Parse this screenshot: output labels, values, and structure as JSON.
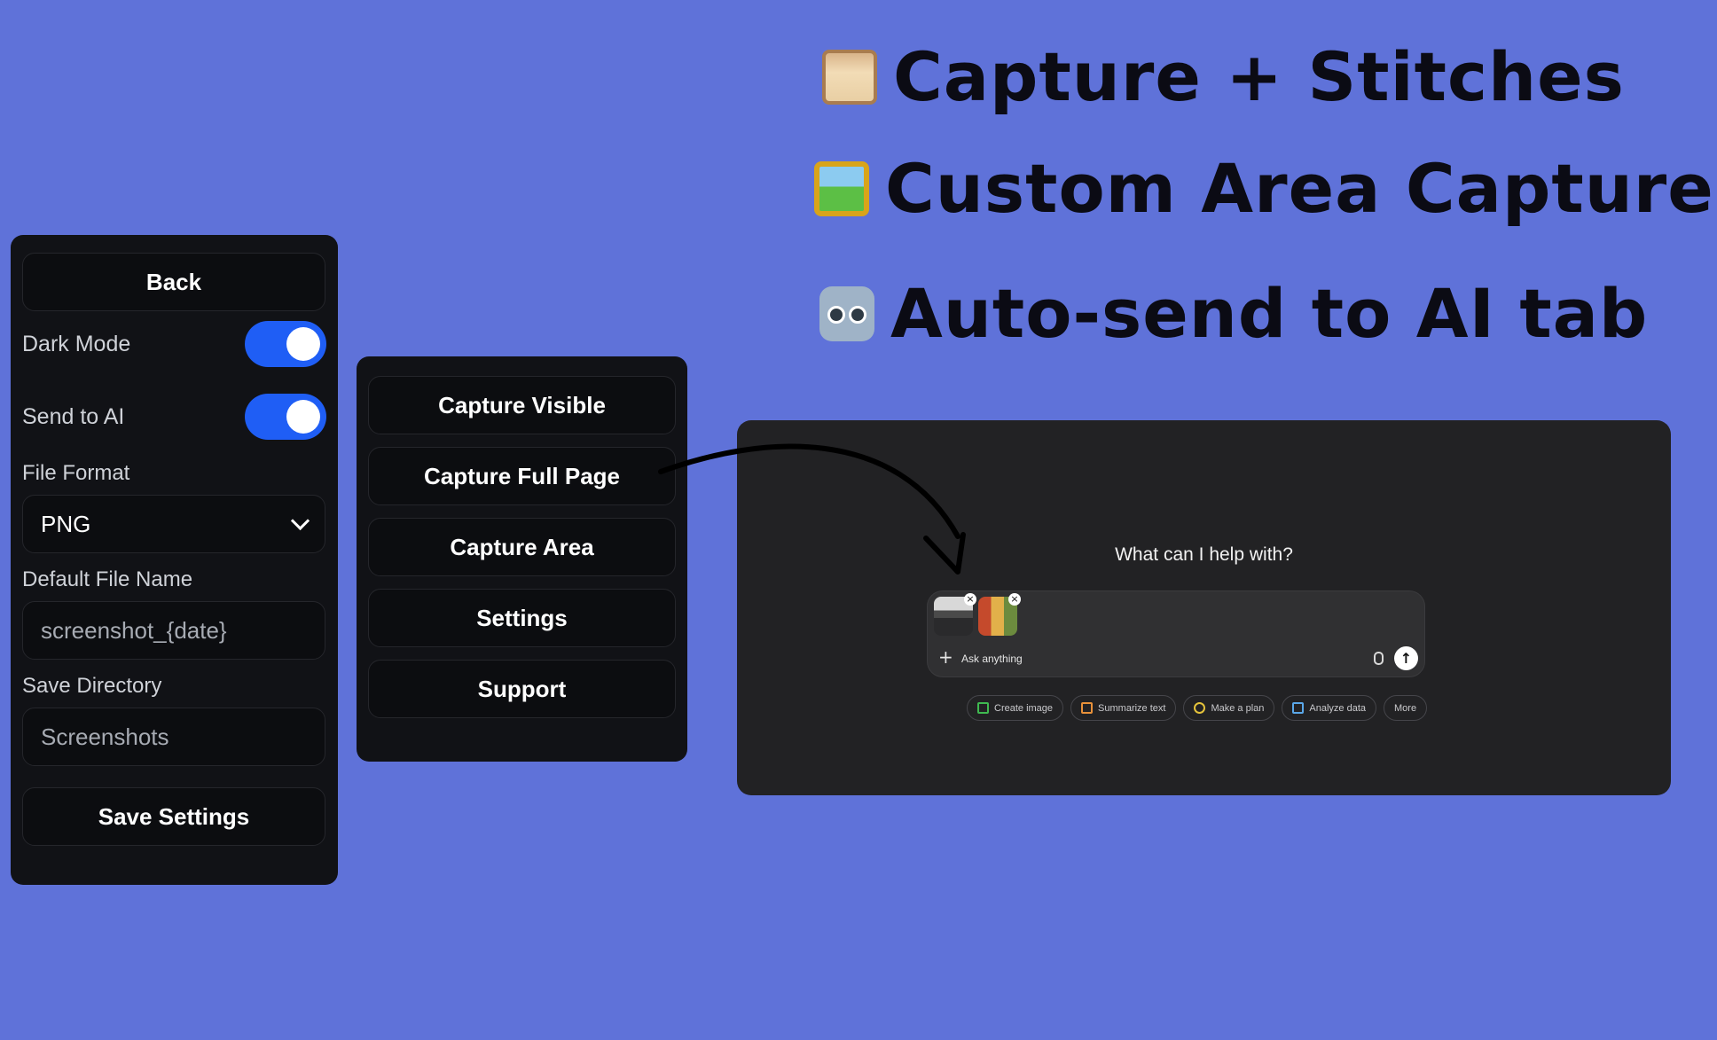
{
  "headlines": [
    {
      "icon": "scroll-icon",
      "text": "Capture + Stitches"
    },
    {
      "icon": "framed-picture-icon",
      "text": "Custom Area Capture"
    },
    {
      "icon": "robot-icon",
      "text": "Auto-send to AI tab"
    }
  ],
  "settings": {
    "back_label": "Back",
    "dark_mode_label": "Dark Mode",
    "dark_mode_on": true,
    "send_to_ai_label": "Send to AI",
    "send_to_ai_on": true,
    "file_format_label": "File Format",
    "file_format_value": "PNG",
    "default_file_name_label": "Default File Name",
    "default_file_name_value": "screenshot_{date}",
    "save_directory_label": "Save Directory",
    "save_directory_value": "Screenshots",
    "save_label": "Save Settings"
  },
  "menu": {
    "items": [
      "Capture Visible",
      "Capture Full Page",
      "Capture Area",
      "Settings",
      "Support"
    ]
  },
  "chat": {
    "title": "What can I help with?",
    "placeholder": "Ask anything",
    "chips": [
      {
        "label": "Create image",
        "icon": "image-icon",
        "color": "#3fb950"
      },
      {
        "label": "Summarize text",
        "icon": "document-icon",
        "color": "#e8913a"
      },
      {
        "label": "Make a plan",
        "icon": "lightbulb-icon",
        "color": "#e5c33b"
      },
      {
        "label": "Analyze data",
        "icon": "chart-icon",
        "color": "#5aa7e8"
      },
      {
        "label": "More",
        "icon": "",
        "color": ""
      }
    ]
  },
  "colors": {
    "background": "#5F72D9",
    "panel": "#111216",
    "toggle_on": "#1f5ef5",
    "chat_bg": "#222224"
  }
}
